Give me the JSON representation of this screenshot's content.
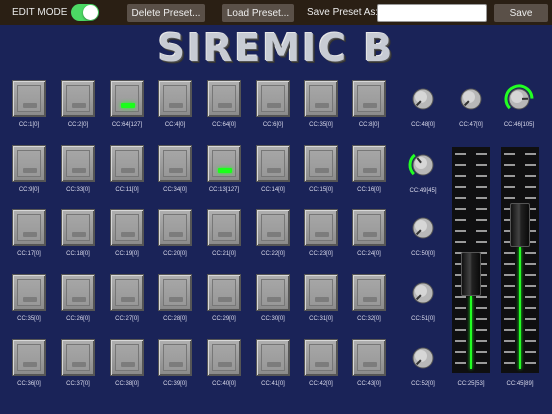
{
  "topbar": {
    "edit_mode_label": "EDIT MODE",
    "edit_mode_on": true,
    "delete_label": "Delete Preset...",
    "load_label": "Load Preset...",
    "save_as_label": "Save Preset As:",
    "preset_name_value": "",
    "save_label": "Save"
  },
  "title": "SIREMIC B",
  "colors": {
    "background": "#1a2358",
    "topbar": "#2a1f14",
    "accent": "#22ff22",
    "toggle": "#4cd964"
  },
  "pads": [
    [
      {
        "label": "CC:1[0]",
        "on": false
      },
      {
        "label": "CC:2[0]",
        "on": false
      },
      {
        "label": "CC:64[127]",
        "on": true
      },
      {
        "label": "CC:4[0]",
        "on": false
      },
      {
        "label": "CC:64[0]",
        "on": false
      },
      {
        "label": "CC:6[0]",
        "on": false
      },
      {
        "label": "CC:35[0]",
        "on": false
      },
      {
        "label": "CC:8[0]",
        "on": false
      }
    ],
    [
      {
        "label": "CC:9[0]",
        "on": false
      },
      {
        "label": "CC:33[0]",
        "on": false
      },
      {
        "label": "CC:11[0]",
        "on": false
      },
      {
        "label": "CC:34[0]",
        "on": false
      },
      {
        "label": "CC:13[127]",
        "on": true
      },
      {
        "label": "CC:14[0]",
        "on": false
      },
      {
        "label": "CC:15[0]",
        "on": false
      },
      {
        "label": "CC:16[0]",
        "on": false
      }
    ],
    [
      {
        "label": "CC:17[0]",
        "on": false
      },
      {
        "label": "CC:18[0]",
        "on": false
      },
      {
        "label": "CC:19[0]",
        "on": false
      },
      {
        "label": "CC:20[0]",
        "on": false
      },
      {
        "label": "CC:21[0]",
        "on": false
      },
      {
        "label": "CC:22[0]",
        "on": false
      },
      {
        "label": "CC:23[0]",
        "on": false
      },
      {
        "label": "CC:24[0]",
        "on": false
      }
    ],
    [
      {
        "label": "CC:35[0]",
        "on": false
      },
      {
        "label": "CC:26[0]",
        "on": false
      },
      {
        "label": "CC:27[0]",
        "on": false
      },
      {
        "label": "CC:28[0]",
        "on": false
      },
      {
        "label": "CC:29[0]",
        "on": false
      },
      {
        "label": "CC:30[0]",
        "on": false
      },
      {
        "label": "CC:31[0]",
        "on": false
      },
      {
        "label": "CC:32[0]",
        "on": false
      }
    ],
    [
      {
        "label": "CC:36[0]",
        "on": false
      },
      {
        "label": "CC:37[0]",
        "on": false
      },
      {
        "label": "CC:38[0]",
        "on": false
      },
      {
        "label": "CC:39[0]",
        "on": false
      },
      {
        "label": "CC:40[0]",
        "on": false
      },
      {
        "label": "CC:41[0]",
        "on": false
      },
      {
        "label": "CC:42[0]",
        "on": false
      },
      {
        "label": "CC:43[0]",
        "on": false
      }
    ]
  ],
  "knobs": [
    {
      "label": "CC:48[0]",
      "value": 0,
      "max": 127
    },
    {
      "label": "CC:47[0]",
      "value": 0,
      "max": 127
    },
    {
      "label": "CC:46[105]",
      "value": 105,
      "max": 127
    },
    {
      "label": "CC:49[45]",
      "value": 45,
      "max": 127
    },
    {
      "label": "CC:50[0]",
      "value": 0,
      "max": 127
    },
    {
      "label": "CC:51[0]",
      "value": 0,
      "max": 127
    },
    {
      "label": "CC:52[0]",
      "value": 0,
      "max": 127
    }
  ],
  "faders": [
    {
      "label": "CC:25[53]",
      "value": 53,
      "max": 127
    },
    {
      "label": "CC:45[89]",
      "value": 89,
      "max": 127
    }
  ]
}
